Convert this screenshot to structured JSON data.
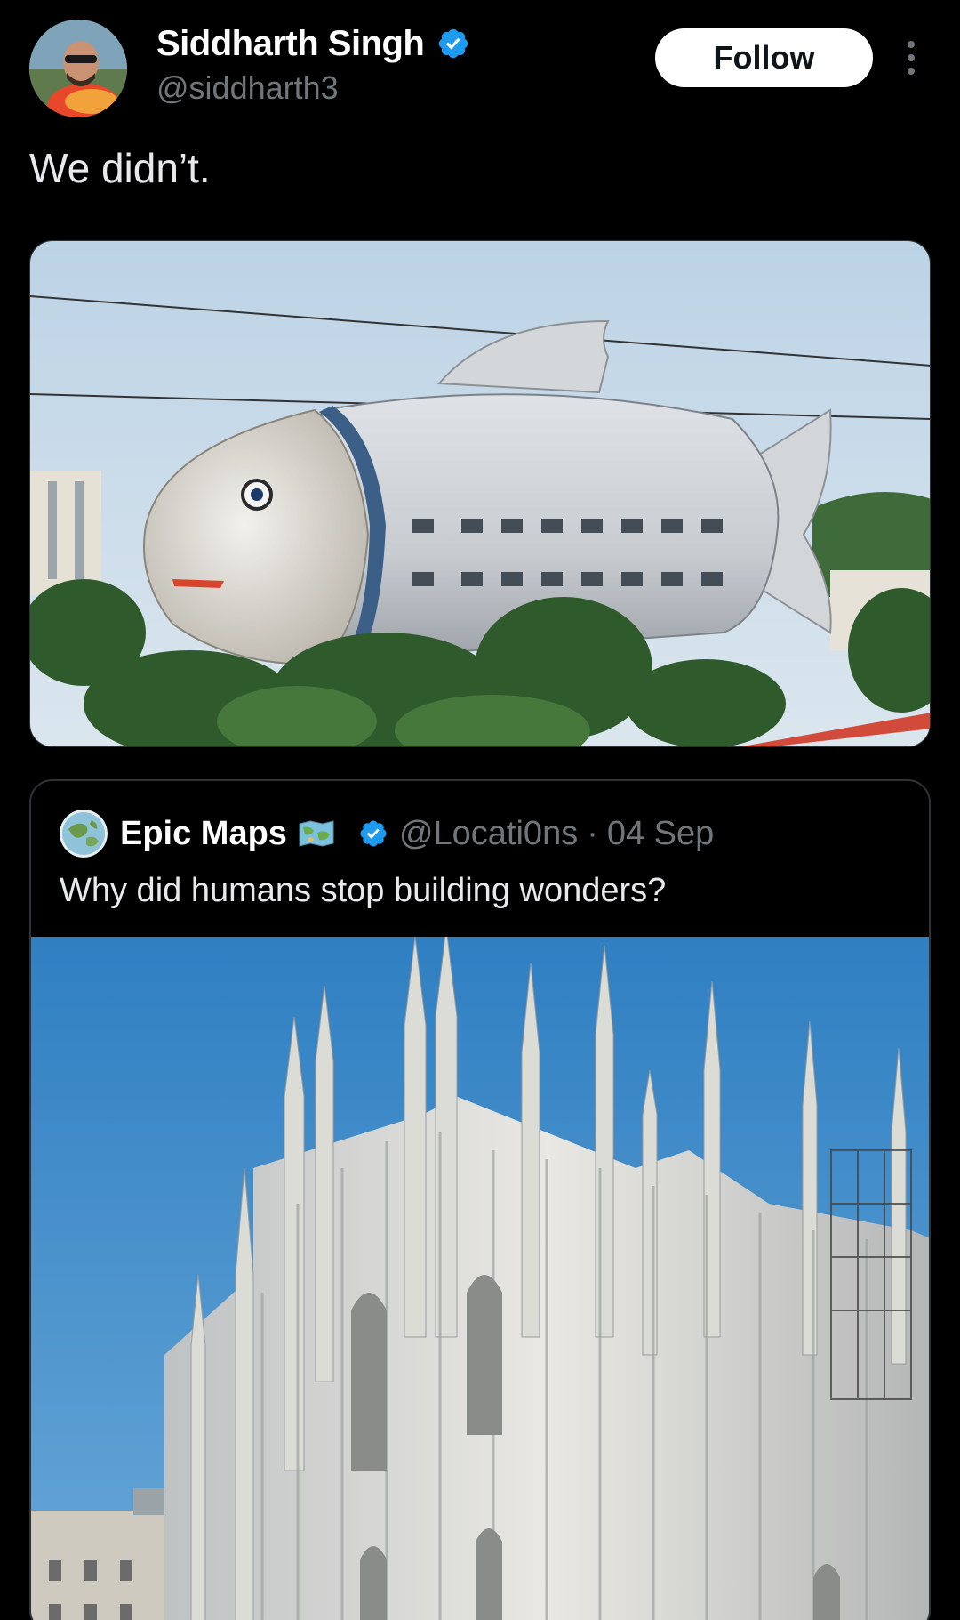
{
  "tweet": {
    "author_name": "Siddharth Singh",
    "author_handle": "@siddharth3",
    "follow_label": "Follow",
    "text": "We didn’t.",
    "media_alt": "fish-shaped building"
  },
  "quote": {
    "author_name": "Epic Maps",
    "author_handle": "@Locati0ns",
    "separator": "·",
    "date": "04 Sep",
    "text": "Why did humans stop building wonders?",
    "media_alt": "gothic cathedral"
  },
  "colors": {
    "background": "#000000",
    "verified": "#1d9bf0",
    "text_primary": "#e7e9ea",
    "text_secondary": "#71767b",
    "follow_bg": "#ffffff"
  },
  "icons": [
    "verified-badge-icon",
    "more-options-icon",
    "map-emoji-icon",
    "globe-avatar-icon"
  ]
}
